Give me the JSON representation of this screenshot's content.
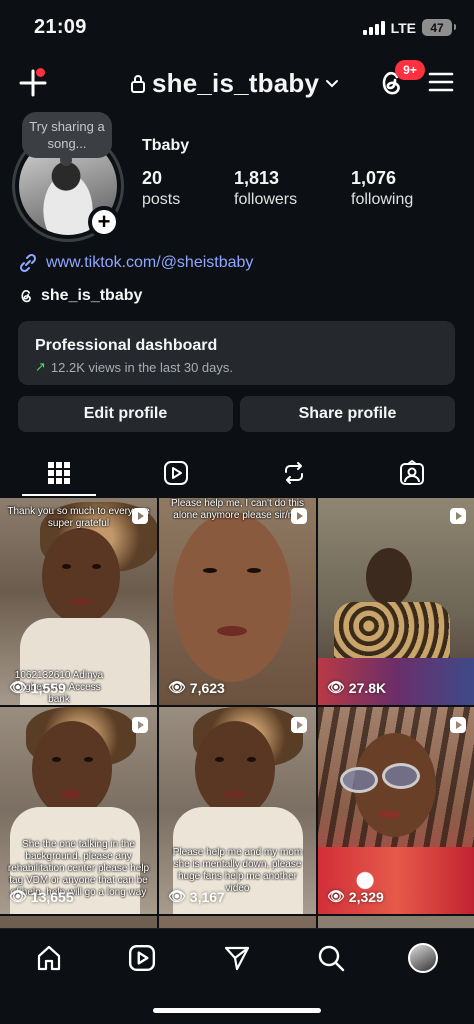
{
  "status": {
    "time": "21:09",
    "network": "LTE",
    "battery": "47"
  },
  "header": {
    "username": "she_is_tbaby",
    "notification_badge": "9+",
    "colors": {
      "badge": "#ff3040",
      "background": "#0c1014"
    }
  },
  "profile": {
    "note": "Try sharing a song...",
    "display_name": "Tbaby",
    "stats": [
      {
        "number": "20",
        "label": "posts"
      },
      {
        "number": "1,813",
        "label": "followers"
      },
      {
        "number": "1,076",
        "label": "following"
      }
    ],
    "link": "www.tiktok.com/@sheistbaby",
    "threads_handle": "she_is_tbaby"
  },
  "dashboard": {
    "title": "Professional dashboard",
    "subtitle": "12.2K views in the last 30 days."
  },
  "buttons": {
    "edit": "Edit profile",
    "share": "Share profile"
  },
  "tabs": [
    "grid-icon",
    "reels-icon",
    "reposts-icon",
    "tagged-icon"
  ],
  "grid": [
    {
      "views": "1,559",
      "top_text": "Thank you so much to everyone super grateful",
      "bottom_text": "1062132610 Adinya Ogbeyemo Access bank"
    },
    {
      "views": "7,623",
      "top_text": "Please help me, I can't do this alone anymore please sir/ma",
      "bottom_text": ""
    },
    {
      "views": "27.8K",
      "top_text": "",
      "bottom_text": ""
    },
    {
      "views": "13,655",
      "top_text": "",
      "bottom_text": "She the one talking in the background, please any rehabilitation center please help tag VDM or anyone that can be of help, help will go a long way"
    },
    {
      "views": "3,167",
      "top_text": "",
      "bottom_text": "Please help me and my mom she is mentally down, please huge fans help me another video"
    },
    {
      "views": "2,329",
      "top_text": "",
      "bottom_text": ""
    }
  ],
  "nav": [
    "home-icon",
    "reels-icon",
    "send-icon",
    "search-icon",
    "profile-avatar"
  ]
}
